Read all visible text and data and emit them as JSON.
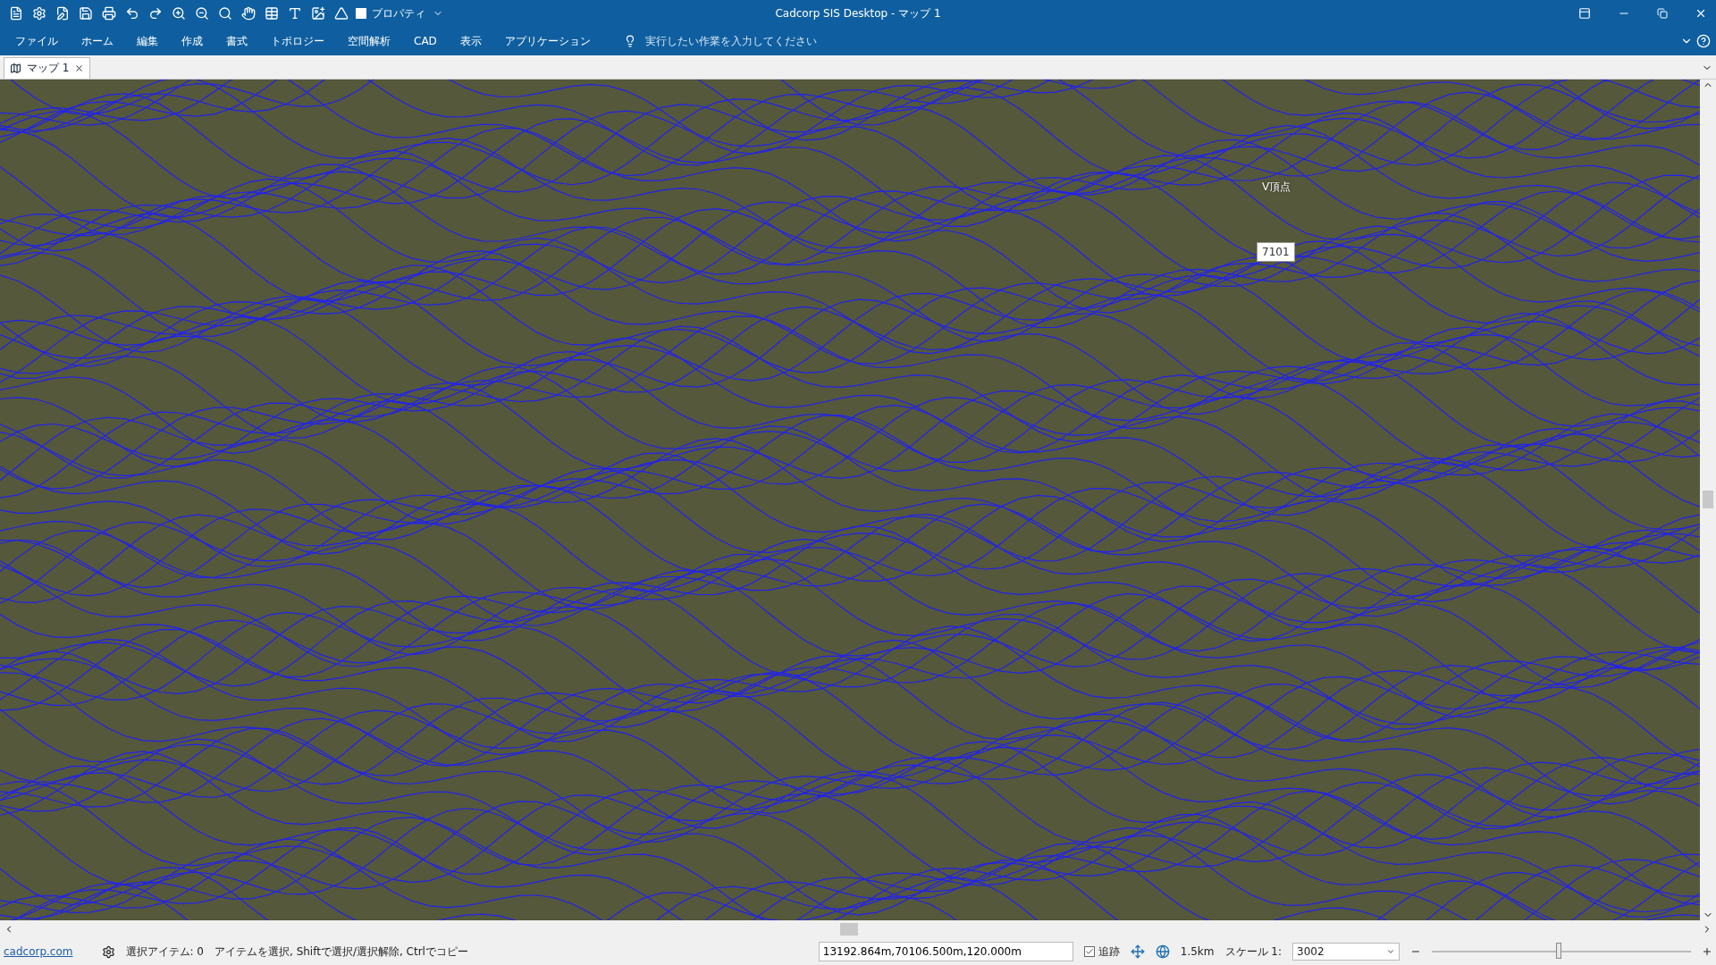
{
  "window": {
    "title": "Cadcorp SIS Desktop - マップ 1"
  },
  "quick_access": {
    "property_checked": false,
    "property_label": "プロパティ"
  },
  "menu": [
    {
      "label": "ファイル"
    },
    {
      "label": "ホーム"
    },
    {
      "label": "編集"
    },
    {
      "label": "作成"
    },
    {
      "label": "書式"
    },
    {
      "label": "トポロジー"
    },
    {
      "label": "空間解析"
    },
    {
      "label": "CAD"
    },
    {
      "label": "表示"
    },
    {
      "label": "アプリケーション"
    }
  ],
  "tell_me": {
    "placeholder": "実行したい作業を入力してください"
  },
  "tabs": [
    {
      "label": "マップ 1",
      "selected": true
    }
  ],
  "map": {
    "labels": [
      {
        "text": "V頂点",
        "kind": "plain"
      },
      {
        "text": "7101",
        "kind": "boxed"
      }
    ]
  },
  "status_bar": {
    "link": "cadcorp.com",
    "selection": "選択アイテム: 0",
    "hint": "アイテムを選択, Shiftで選択/選択解除, Ctrlでコピー",
    "coordinates": "13192.864m,70106.500m,120.000m",
    "tracking_label": "追跡",
    "tracking_checked": true,
    "distance": "1.5km",
    "scale_label": "スケール 1:",
    "scale_value": "3002",
    "zoom": {
      "level": 0.49
    }
  }
}
